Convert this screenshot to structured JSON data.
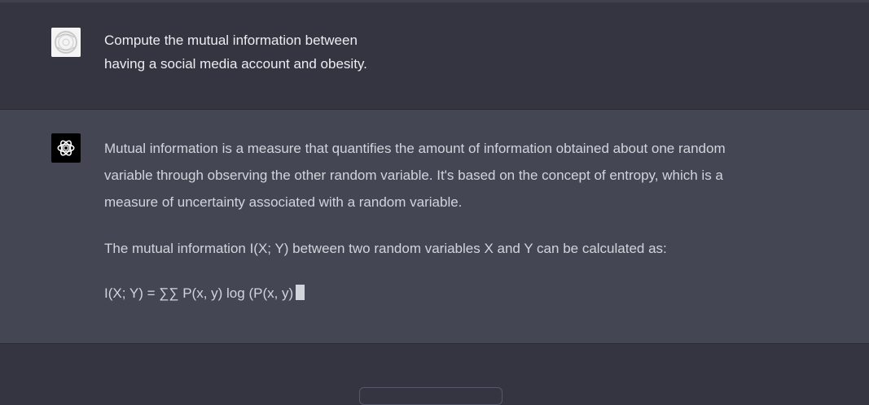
{
  "conversation": {
    "user": {
      "avatar": "user-avatar-image",
      "message_line1": "Compute the mutual information between",
      "message_line2": "having a social media account and obesity."
    },
    "assistant": {
      "avatar": "openai-logo-icon",
      "paragraph1": "Mutual information is a measure that quantifies the amount of information obtained about one random variable through observing the other random variable. It's based on the concept of entropy, which is a measure of uncertainty associated with a random variable.",
      "paragraph2": "The mutual information I(X; Y) between two random variables X and Y can be calculated as:",
      "formula": "I(X; Y) = ∑∑ P(x, y) log (P(x, y)"
    }
  },
  "colors": {
    "background": "#343541",
    "assistant_background": "#444654",
    "text": "#d1d5db",
    "user_text": "#ececf1"
  }
}
